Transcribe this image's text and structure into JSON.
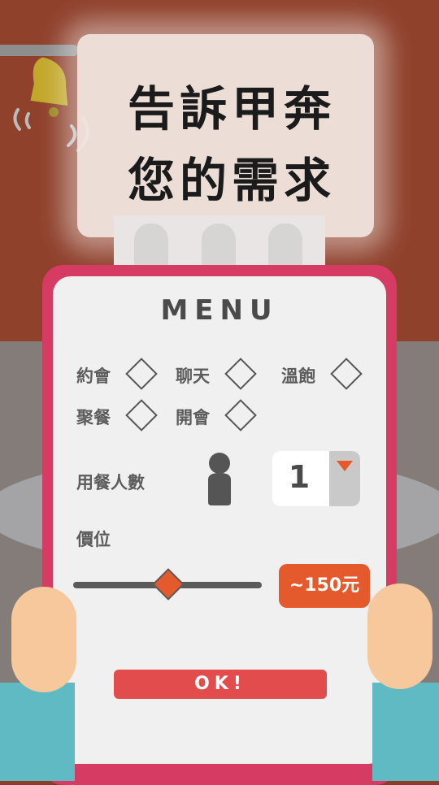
{
  "sign": {
    "line1": "告訴甲奔",
    "line2": "您的需求"
  },
  "menu": {
    "title": "MENU",
    "options": [
      "約會",
      "聊天",
      "溫飽",
      "聚餐",
      "開會"
    ],
    "people_label": "用餐人數",
    "people_value": "1",
    "price_label": "價位",
    "price_value": "~150元",
    "ok_label": "OK!"
  },
  "colors": {
    "wall": "#8f412c",
    "tablet": "#d63b63",
    "accent": "#e55a2c",
    "ok_button": "#e34c4c",
    "sleeve": "#5fbac4"
  },
  "icons": [
    "bell-icon",
    "person-icon",
    "dropdown-arrow-icon"
  ]
}
